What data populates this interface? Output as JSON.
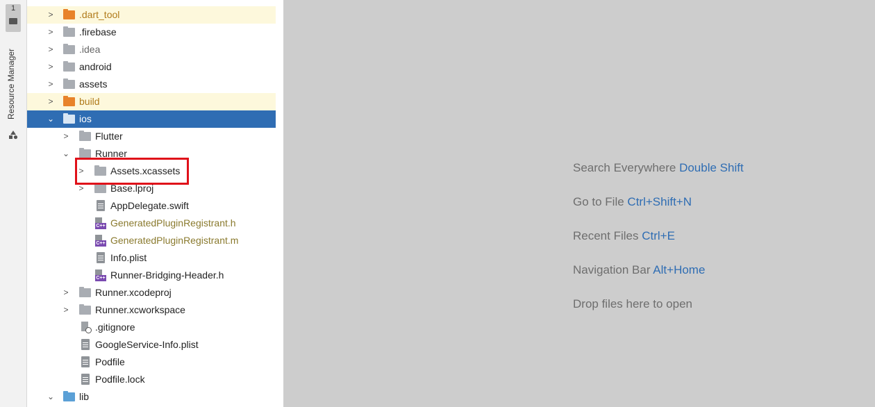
{
  "toolstrip": {
    "project_tab_number": "1",
    "resource_manager_label": "Resource Manager"
  },
  "tree": {
    "items": [
      {
        "label": ".dart_tool",
        "icon": "folder-orange-icon",
        "chevron": ">"
      },
      {
        "label": ".firebase",
        "icon": "folder-icon",
        "chevron": ">"
      },
      {
        "label": ".idea",
        "icon": "folder-settings-icon",
        "chevron": ">"
      },
      {
        "label": "android",
        "icon": "folder-module-icon",
        "chevron": ">"
      },
      {
        "label": "assets",
        "icon": "folder-icon",
        "chevron": ">"
      },
      {
        "label": "build",
        "icon": "folder-orange-settings-icon",
        "chevron": ">"
      },
      {
        "label": "ios",
        "icon": "folder-module-icon",
        "chevron": "⌄"
      },
      {
        "label": "Flutter",
        "icon": "folder-icon",
        "chevron": ">"
      },
      {
        "label": "Runner",
        "icon": "folder-icon",
        "chevron": "⌄"
      },
      {
        "label": "Assets.xcassets",
        "icon": "folder-icon",
        "chevron": ">"
      },
      {
        "label": "Base.lproj",
        "icon": "folder-icon",
        "chevron": ">"
      },
      {
        "label": "AppDelegate.swift",
        "icon": "text-file-icon",
        "chevron": ""
      },
      {
        "label": "GeneratedPluginRegistrant.h",
        "icon": "cpp-header-file-icon",
        "chevron": ""
      },
      {
        "label": "GeneratedPluginRegistrant.m",
        "icon": "cpp-source-file-icon",
        "chevron": ""
      },
      {
        "label": "Info.plist",
        "icon": "text-file-icon",
        "chevron": ""
      },
      {
        "label": "Runner-Bridging-Header.h",
        "icon": "cpp-header-file-icon",
        "chevron": ""
      },
      {
        "label": "Runner.xcodeproj",
        "icon": "folder-icon",
        "chevron": ">"
      },
      {
        "label": "Runner.xcworkspace",
        "icon": "folder-icon",
        "chevron": ">"
      },
      {
        "label": ".gitignore",
        "icon": "gitignore-file-icon",
        "chevron": ""
      },
      {
        "label": "GoogleService-Info.plist",
        "icon": "text-file-icon",
        "chevron": ""
      },
      {
        "label": "Podfile",
        "icon": "text-file-icon",
        "chevron": ""
      },
      {
        "label": "Podfile.lock",
        "icon": "text-file-icon",
        "chevron": ""
      },
      {
        "label": "lib",
        "icon": "folder-blue-icon",
        "chevron": "⌄"
      }
    ]
  },
  "editor": {
    "hints": [
      {
        "text": "Search Everywhere ",
        "key": "Double Shift"
      },
      {
        "text": "Go to File ",
        "key": "Ctrl+Shift+N"
      },
      {
        "text": "Recent Files ",
        "key": "Ctrl+E"
      },
      {
        "text": "Navigation Bar ",
        "key": "Alt+Home"
      },
      {
        "text": "Drop files here to open",
        "key": ""
      }
    ]
  },
  "colors": {
    "selection": "#2f6db3",
    "excluded_highlight": "#fdf8dc",
    "annotation_box": "#e0111a",
    "editor_background": "#cdcdcd"
  }
}
